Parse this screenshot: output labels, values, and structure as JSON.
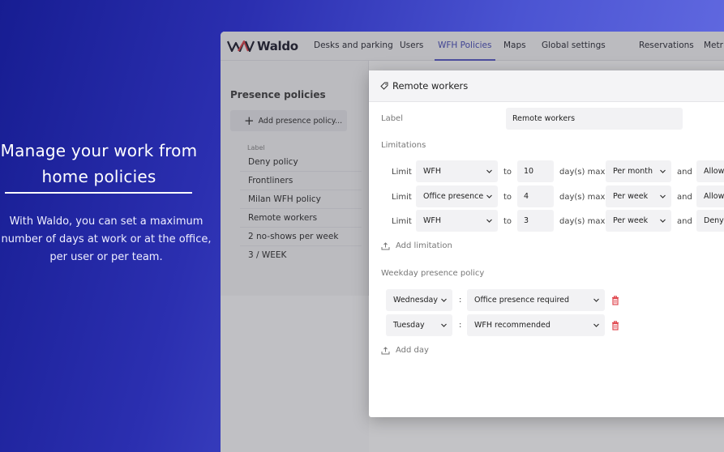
{
  "promo": {
    "title_line1": "Manage your work from",
    "title_line2": "home policies",
    "body_line1": "With Waldo, you can set a maximum",
    "body_line2": "number of days at work or at the office,",
    "body_line3": "per user or per team."
  },
  "app": {
    "logo_text": "Waldo",
    "nav": [
      "Desks and parking",
      "Users",
      "WFH Policies",
      "Maps",
      "Global settings",
      "Reservations",
      "Metri"
    ],
    "active_nav": "WFH Policies"
  },
  "sidebar": {
    "title": "Presence policies",
    "add_button": "Add presence policy...",
    "list_header": "Label",
    "policies": [
      "Deny policy",
      "Frontliners",
      "Milan WFH policy",
      "Remote workers",
      "2 no-shows per week",
      "3 / WEEK"
    ]
  },
  "modal": {
    "title": "Remote workers",
    "label_caption": "Label",
    "label_value": "Remote workers",
    "limitations_caption": "Limitations",
    "limit_word": "Limit",
    "to_word": "to",
    "days_max": "day(s) max",
    "and_word": "and",
    "limitations": [
      {
        "type": "WFH",
        "count": "10",
        "period": "Per month",
        "action": "Allow"
      },
      {
        "type": "Office presence",
        "count": "4",
        "period": "Per week",
        "action": "Allow"
      },
      {
        "type": "WFH",
        "count": "3",
        "period": "Per week",
        "action": "Deny"
      }
    ],
    "add_limitation": "Add limitation",
    "weekday_caption": "Weekday presence policy",
    "colon": ":",
    "weekday_rules": [
      {
        "day": "Wednesday",
        "rule": "Office presence required"
      },
      {
        "day": "Tuesday",
        "rule": "WFH recommended"
      }
    ],
    "add_day": "Add day"
  },
  "colors": {
    "accent": "#4a4fb8",
    "trash": "#e0484f",
    "bg_gradient_start": "#171d92",
    "bg_gradient_end": "#6a72e6"
  }
}
